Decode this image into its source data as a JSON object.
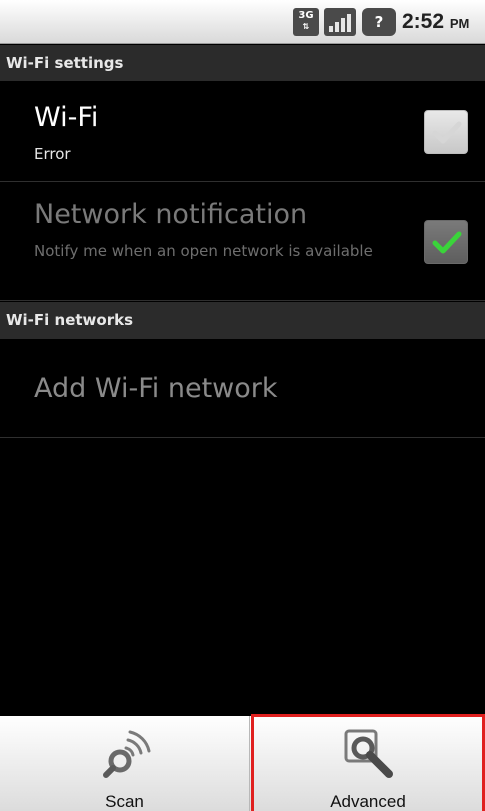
{
  "status_bar": {
    "network_label": "3G",
    "network_arrows": "⇅",
    "battery_glyph": "?",
    "time": "2:52",
    "ampm": "PM",
    "icons": [
      "network-3g-icon",
      "signal-strength-icon",
      "battery-icon"
    ]
  },
  "wifi_settings": {
    "header": "Wi-Fi settings",
    "wifi": {
      "title": "Wi-Fi",
      "summary": "Error",
      "checked": true,
      "enabled": false
    },
    "network_notification": {
      "title": "Network notification",
      "summary": "Notify me when an open network is available",
      "checked": true,
      "enabled": false
    }
  },
  "wifi_networks": {
    "header": "Wi-Fi networks",
    "add_network": "Add Wi-Fi network"
  },
  "options_menu": {
    "items": [
      {
        "label": "Scan",
        "icon": "scan-wifi-icon"
      },
      {
        "label": "Advanced",
        "icon": "advanced-settings-icon"
      }
    ],
    "highlighted": "Advanced",
    "highlight_color": "#e0201f"
  },
  "colors": {
    "checkmark_green": "#3ad43a",
    "disabled_text": "#7a7a7a"
  }
}
